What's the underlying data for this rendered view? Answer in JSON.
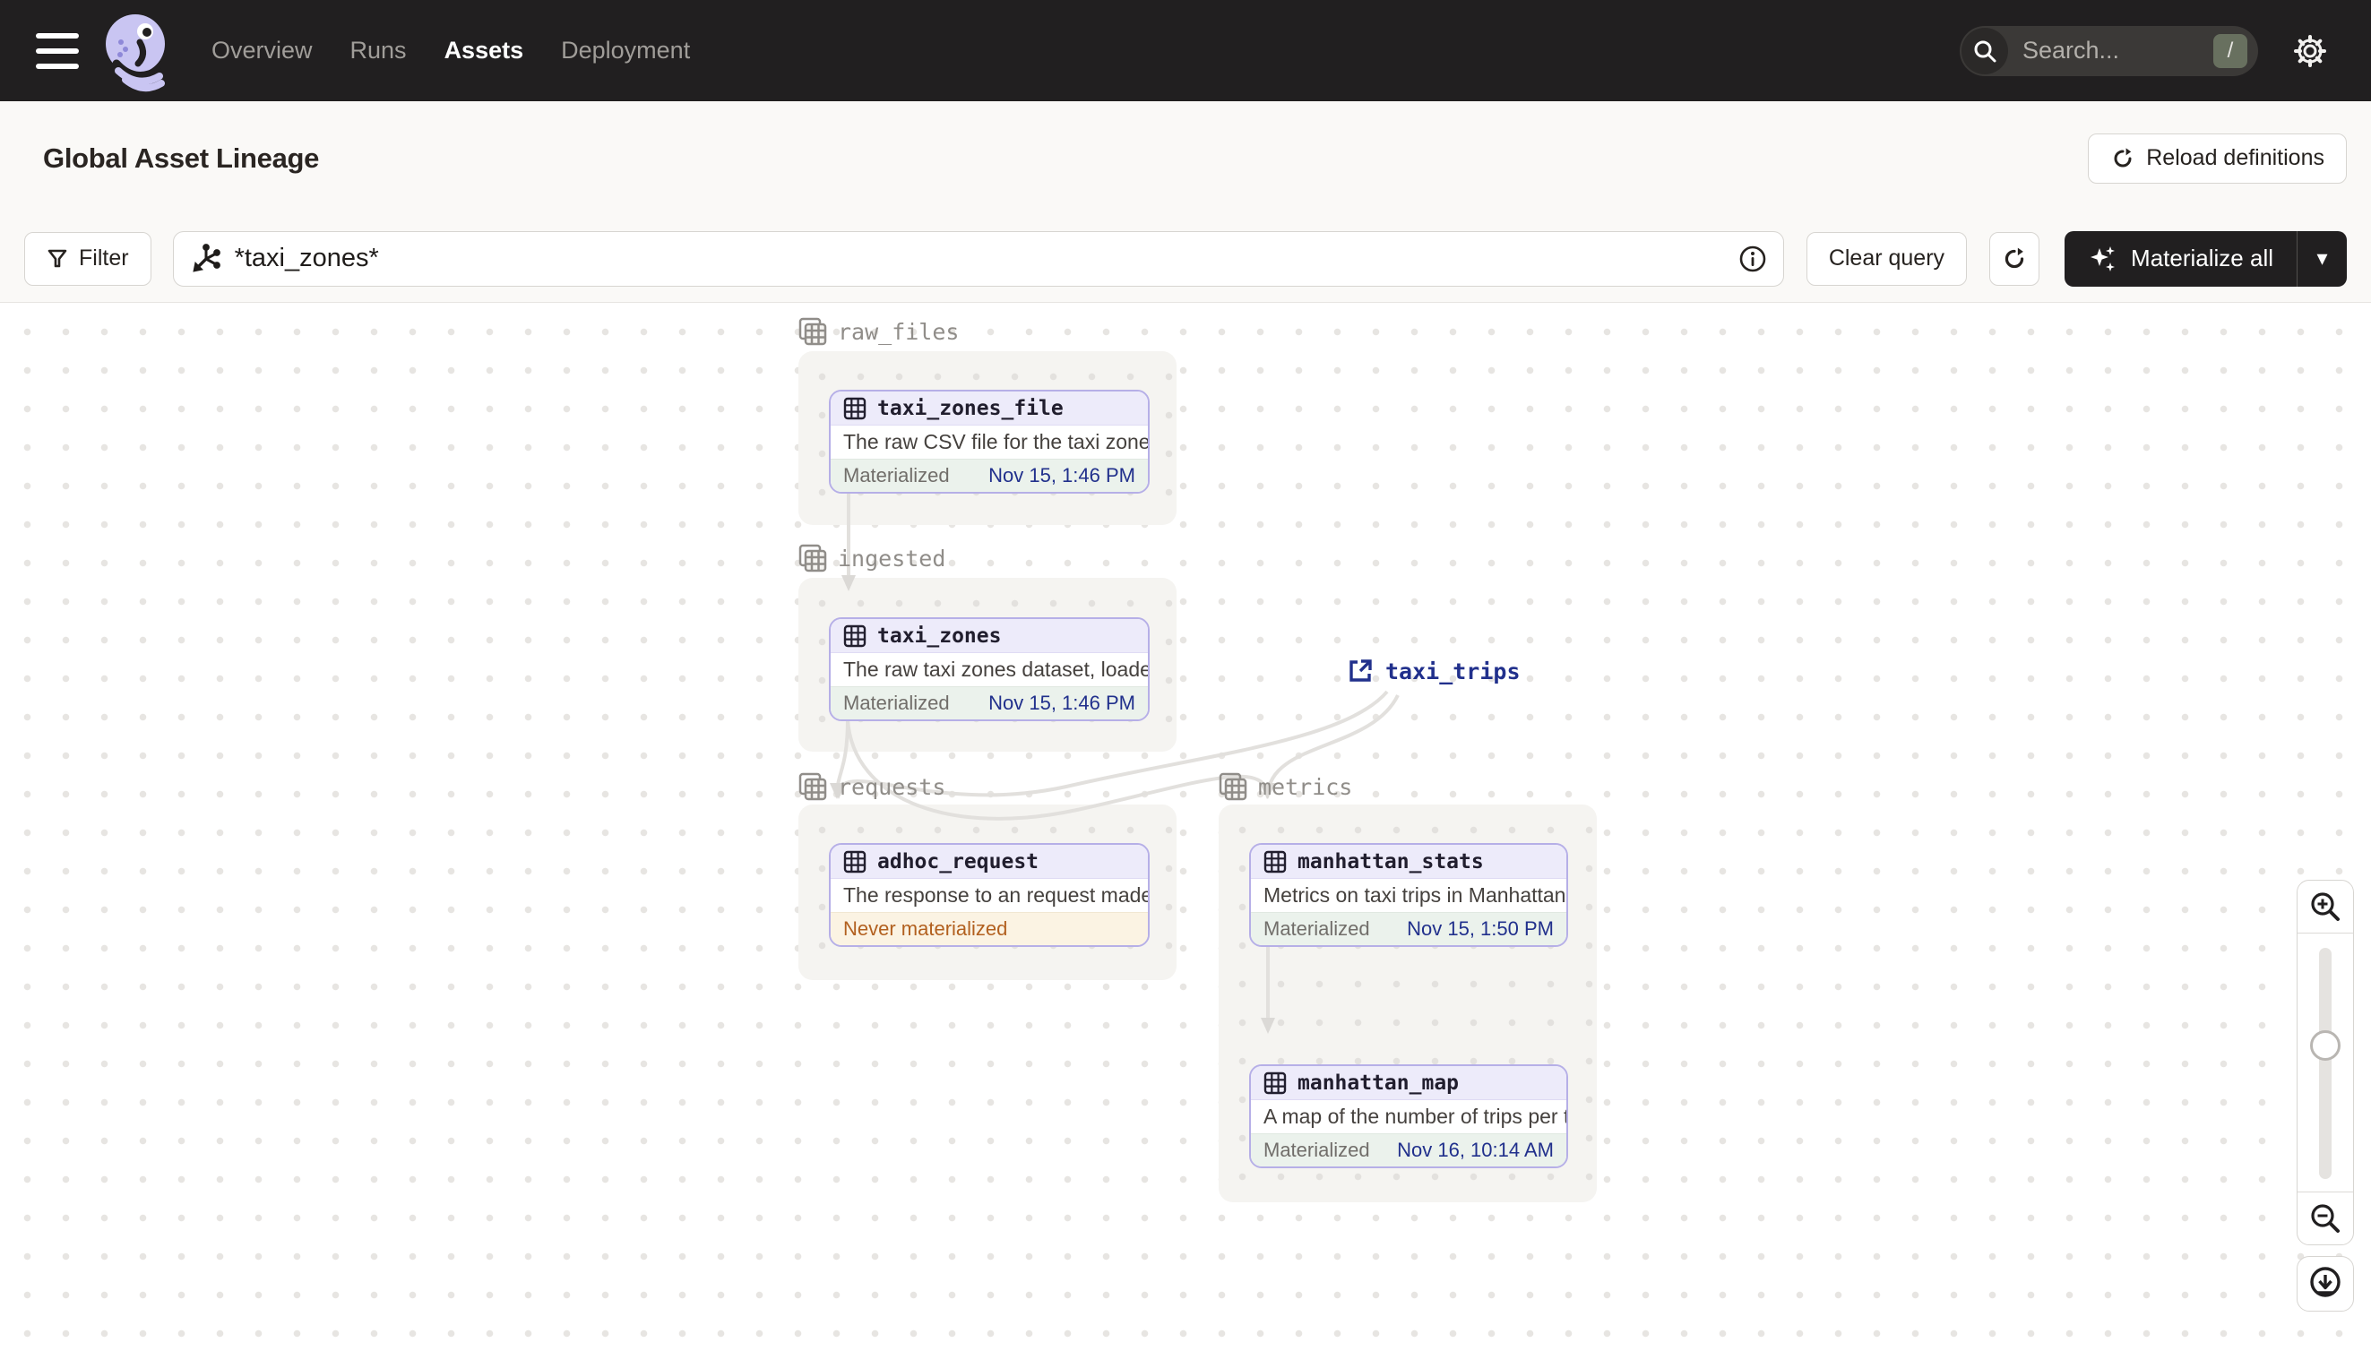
{
  "nav": {
    "items": [
      {
        "label": "Overview",
        "active": false
      },
      {
        "label": "Runs",
        "active": false
      },
      {
        "label": "Assets",
        "active": true
      },
      {
        "label": "Deployment",
        "active": false
      }
    ],
    "search": {
      "placeholder": "Search...",
      "shortcut": "/"
    }
  },
  "header": {
    "title": "Global Asset Lineage",
    "reload_label": "Reload definitions"
  },
  "toolbar": {
    "filter_label": "Filter",
    "query_value": "*taxi_zones*",
    "clear_label": "Clear query",
    "materialize_label": "Materialize all"
  },
  "graph": {
    "groups": [
      {
        "name": "raw_files"
      },
      {
        "name": "ingested"
      },
      {
        "name": "requests"
      },
      {
        "name": "metrics"
      }
    ],
    "nodes": [
      {
        "name": "taxi_zones_file",
        "description": "The raw CSV file for the taxi zones dat...",
        "status": "Materialized",
        "status_time": "Nov 15, 1:46 PM",
        "status_kind": "materialized",
        "group": "raw_files"
      },
      {
        "name": "taxi_zones",
        "description": "The raw taxi zones dataset, loaded int...",
        "status": "Materialized",
        "status_time": "Nov 15, 1:46 PM",
        "status_kind": "materialized",
        "group": "ingested"
      },
      {
        "name": "adhoc_request",
        "description": "The response to an request made in th...",
        "status": "Never materialized",
        "status_time": "",
        "status_kind": "never",
        "group": "requests"
      },
      {
        "name": "manhattan_stats",
        "description": "Metrics on taxi trips in Manhattan",
        "status": "Materialized",
        "status_time": "Nov 15, 1:50 PM",
        "status_kind": "materialized",
        "group": "metrics"
      },
      {
        "name": "manhattan_map",
        "description": "A map of the number of trips per taxi z...",
        "status": "Materialized",
        "status_time": "Nov 16, 10:14 AM",
        "status_kind": "materialized",
        "group": "metrics"
      }
    ],
    "external_nodes": [
      {
        "name": "taxi_trips"
      }
    ],
    "edges": [
      {
        "from": "taxi_zones_file",
        "to": "taxi_zones"
      },
      {
        "from": "taxi_zones",
        "to": "adhoc_request"
      },
      {
        "from": "taxi_zones",
        "to": "manhattan_stats"
      },
      {
        "from": "taxi_trips",
        "to": "adhoc_request"
      },
      {
        "from": "taxi_trips",
        "to": "manhattan_stats"
      },
      {
        "from": "manhattan_stats",
        "to": "manhattan_map"
      }
    ]
  },
  "icons": {
    "hamburger": "menu",
    "dagster-logo": "octopus",
    "search": "magnifier",
    "gear": "settings",
    "reload": "circular-arrow",
    "filter": "funnel",
    "query-graph": "asset-splat",
    "info": "circled-i",
    "refresh": "circular-arrow",
    "sparkle": "materialize-stars",
    "caret-down": "down-triangle",
    "table": "grid-table",
    "group-table": "layered-grid-table",
    "external-link": "box-arrow",
    "zoom-in": "magnifier-plus",
    "zoom-out": "magnifier-minus",
    "download": "circled-down-arrow"
  },
  "colors": {
    "nav_bg": "#211F20",
    "accent_lavender": "#B6AFE7",
    "node_header": "#EDEBFA",
    "materialized_bg": "#EBF2EC",
    "never_bg": "#FBF3E3",
    "navy": "#21308C",
    "orange": "#B2601F",
    "edge": "#E2E0DD",
    "page_bg": "#FAF9F7"
  }
}
